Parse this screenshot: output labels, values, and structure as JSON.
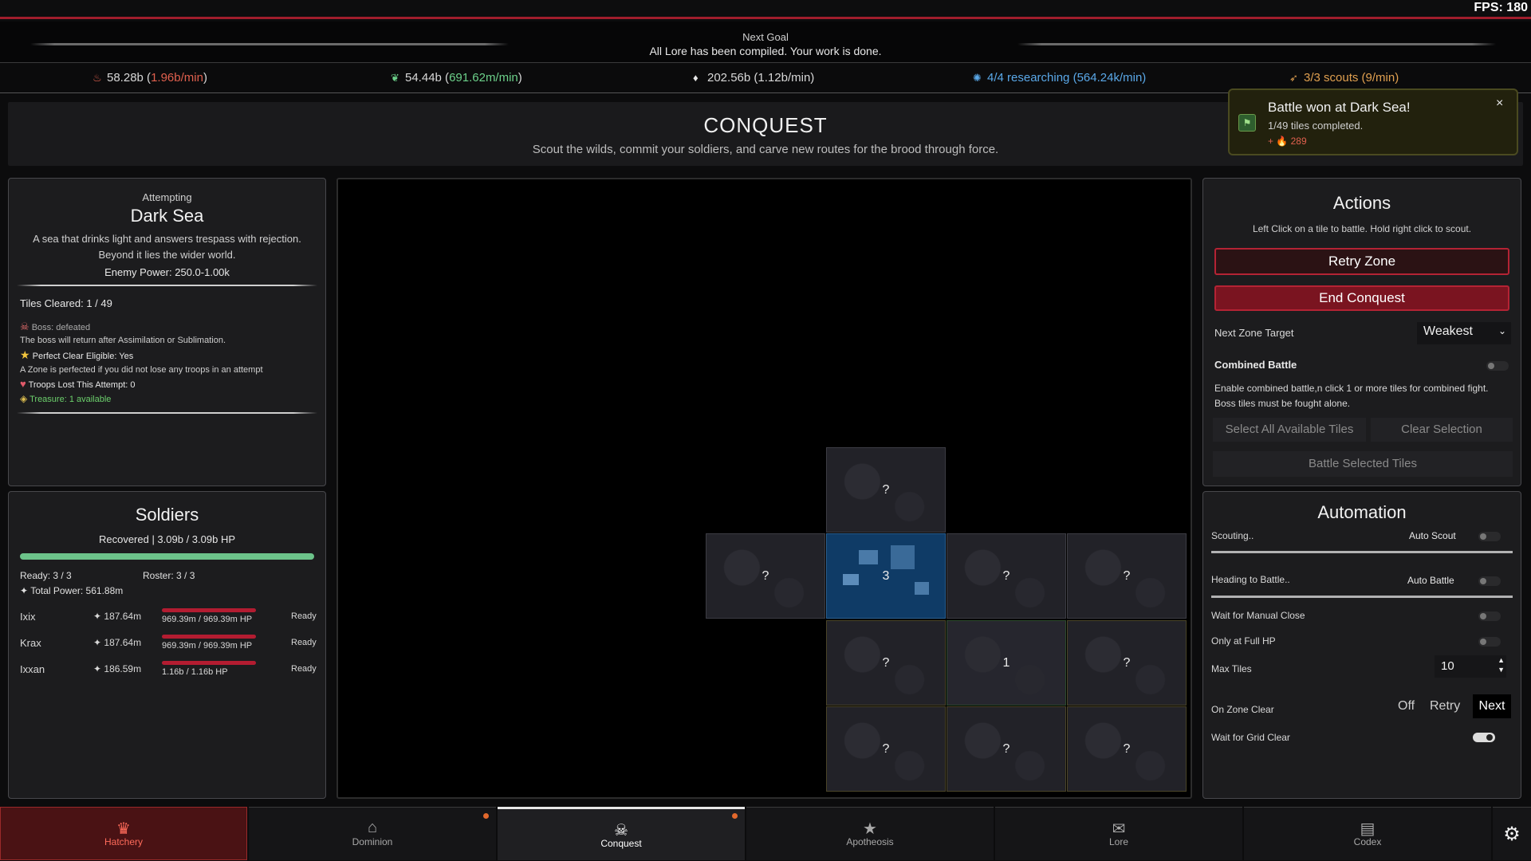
{
  "fps": "FPS: 180",
  "goal": {
    "label": "Next Goal",
    "text": "All Lore has been compiled. Your work is done."
  },
  "resources": [
    {
      "icon": "flame-icon",
      "value": "58.28b",
      "rate": "1.96b/min",
      "rate_color": "#e0604e"
    },
    {
      "icon": "leaf-icon",
      "value": "54.44b",
      "rate": "691.62m/min",
      "rate_color": "#6cd08a"
    },
    {
      "icon": "drop-icon",
      "value": "202.56b",
      "rate": "1.12b/min",
      "rate_color": "#e6e6e6"
    },
    {
      "icon": "brain-icon",
      "value": "4/4 researching",
      "rate": "564.24k/min",
      "rate_color": "#5aa8e8"
    },
    {
      "icon": "scout-icon",
      "value": "3/3 scouts",
      "rate": "9/min",
      "rate_color": "#e0a050"
    }
  ],
  "header": {
    "title": "CONQUEST",
    "subtitle": "Scout the wilds, commit your soldiers, and carve new routes for the brood through force."
  },
  "toast": {
    "title": "Battle won at Dark Sea!",
    "line": "1/49 tiles completed.",
    "reward": "+ 🔥 289",
    "close": "×"
  },
  "zone": {
    "attempting": "Attempting",
    "name": "Dark Sea",
    "desc": "A sea that drinks light and answers trespass with rejection. Beyond it lies the wider world.",
    "enemy_power": "Enemy Power: 250.0-1.00k",
    "tiles_cleared": "Tiles Cleared: 1 / 49",
    "boss_status": "Boss: defeated",
    "boss_note": "The boss will return after Assimilation or Sublimation.",
    "perfect": "Perfect Clear Eligible: Yes",
    "perfect_note": "A Zone is perfected if you did not lose any troops in an attempt",
    "troops_lost": "Troops Lost This Attempt: 0",
    "treasure": "Treasure: 1 available"
  },
  "soldiers": {
    "title": "Soldiers",
    "status": "Recovered | 3.09b / 3.09b HP",
    "ready": "Ready: 3 / 3",
    "roster": "Roster: 3 / 3",
    "total_power": "Total Power: 561.88m",
    "list": [
      {
        "name": "Ixix",
        "power": "187.64m",
        "hp": "969.39m / 969.39m HP",
        "status": "Ready"
      },
      {
        "name": "Krax",
        "power": "187.64m",
        "hp": "969.39m / 969.39m HP",
        "status": "Ready"
      },
      {
        "name": "Ixxan",
        "power": "186.59m",
        "hp": "1.16b / 1.16b HP",
        "status": "Ready"
      }
    ]
  },
  "tiles": [
    {
      "label": "?",
      "kind": "unknown"
    },
    {
      "label": "?",
      "kind": "unknown"
    },
    {
      "label": "3",
      "kind": "selected"
    },
    {
      "label": "?",
      "kind": "unknown"
    },
    {
      "label": "?",
      "kind": "unknown"
    },
    {
      "label": "?",
      "kind": "unknown"
    },
    {
      "label": "1",
      "kind": "cleared"
    },
    {
      "label": "?",
      "kind": "unknown"
    },
    {
      "label": "?",
      "kind": "unknown"
    },
    {
      "label": "?",
      "kind": "unknown"
    },
    {
      "label": "?",
      "kind": "unknown"
    }
  ],
  "actions": {
    "title": "Actions",
    "hint": "Left Click on a tile to battle. Hold right click to scout.",
    "retry": "Retry Zone",
    "end": "End Conquest",
    "target_label": "Next Zone Target",
    "target_value": "Weakest",
    "combined_label": "Combined Battle",
    "combined_desc": "Enable combined battle,n click 1 or more tiles for combined fight. Boss tiles must be fought alone.",
    "select_all": "Select All Available Tiles",
    "clear_sel": "Clear Selection",
    "battle_sel": "Battle Selected Tiles"
  },
  "automation": {
    "title": "Automation",
    "scouting": "Scouting..",
    "auto_scout": "Auto Scout",
    "heading": "Heading to Battle..",
    "auto_battle": "Auto Battle",
    "manual_close": "Wait for Manual Close",
    "full_hp": "Only at Full HP",
    "max_tiles_label": "Max Tiles",
    "max_tiles_value": "10",
    "zone_clear_label": "On Zone Clear",
    "opt_off": "Off",
    "opt_retry": "Retry",
    "opt_next": "Next",
    "grid_clear": "Wait for Grid Clear"
  },
  "nav": [
    {
      "label": "Hatchery",
      "icon": "crown-icon"
    },
    {
      "label": "Dominion",
      "icon": "home-icon"
    },
    {
      "label": "Conquest",
      "icon": "skull-icon"
    },
    {
      "label": "Apotheosis",
      "icon": "star-icon"
    },
    {
      "label": "Lore",
      "icon": "scroll-icon"
    },
    {
      "label": "Codex",
      "icon": "book-icon"
    }
  ],
  "colors": {
    "accent_red": "#b42334",
    "tile_selected": "#0f3b66",
    "hp_green": "#6cc38a"
  }
}
